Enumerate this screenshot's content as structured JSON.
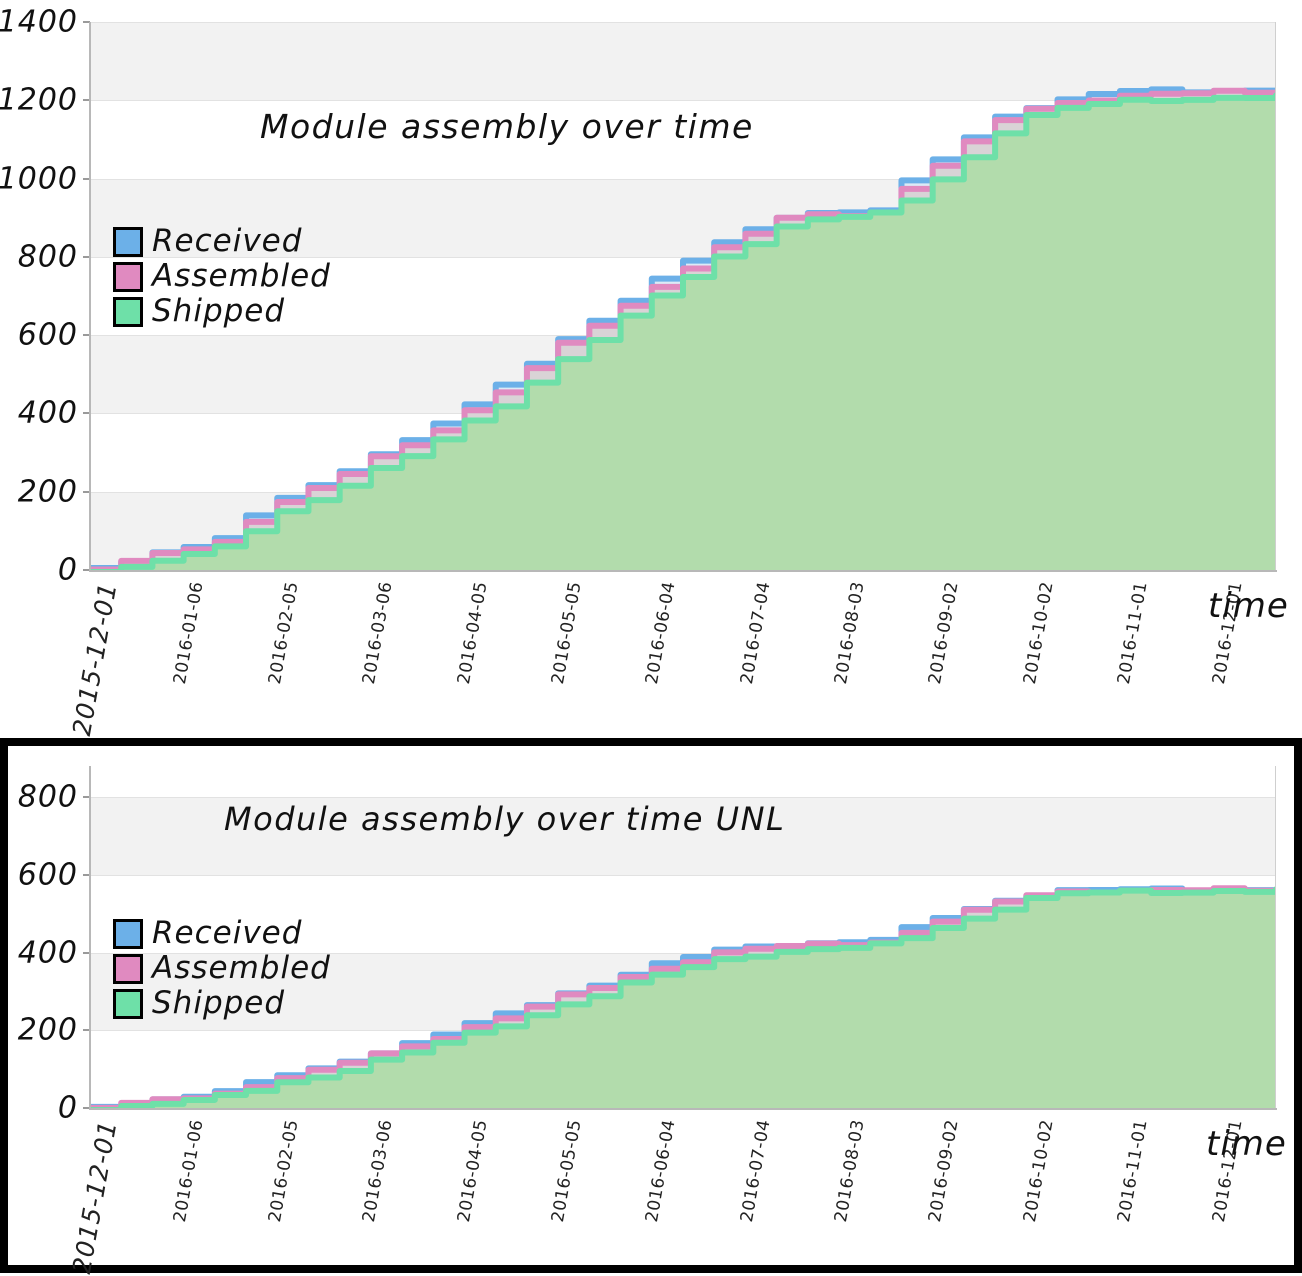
{
  "page": {
    "background": "#ffffff",
    "style": "xkcd-handdrawn"
  },
  "colors": {
    "received_line": "#6cb0e8",
    "received_fill": "#dceaf6",
    "assembled_line": "#e08ac0",
    "assembled_fill": "#d9d3d6",
    "shipped_line": "#6ee0a8",
    "shipped_fill": "#b2dcac",
    "band": "#f2f2f2",
    "grid": "#e2e2e2",
    "text": "#111111",
    "border": "#000000"
  },
  "charts": [
    {
      "id": "module-assembly-over-time",
      "title": "Module assembly over time",
      "xlabel": "time",
      "ylabel": "",
      "legend": [
        {
          "name": "Received",
          "color": "#6cb0e8"
        },
        {
          "name": "Assembled",
          "color": "#e08ac0"
        },
        {
          "name": "Shipped",
          "color": "#6ee0a8"
        }
      ],
      "yticks": [
        "0",
        "200",
        "400",
        "600",
        "800",
        "1000",
        "1200",
        "1400"
      ],
      "xticks": [
        "2015-12-01",
        "2016-01-06",
        "2016-02-05",
        "2016-03-06",
        "2016-04-05",
        "2016-05-05",
        "2016-06-04",
        "2016-07-04",
        "2016-08-03",
        "2016-09-02",
        "2016-10-02",
        "2016-11-01",
        "2016-12-01"
      ]
    },
    {
      "id": "module-assembly-over-time-unl",
      "title": "Module assembly over time  UNL",
      "xlabel": "time",
      "ylabel": "",
      "legend": [
        {
          "name": "Received",
          "color": "#6cb0e8"
        },
        {
          "name": "Assembled",
          "color": "#e08ac0"
        },
        {
          "name": "Shipped",
          "color": "#6ee0a8"
        }
      ],
      "yticks": [
        "0",
        "200",
        "400",
        "600",
        "800"
      ],
      "xticks": [
        "2015-12-01",
        "2016-01-06",
        "2016-02-05",
        "2016-03-06",
        "2016-04-05",
        "2016-05-05",
        "2016-06-04",
        "2016-07-04",
        "2016-08-03",
        "2016-09-02",
        "2016-10-02",
        "2016-11-01",
        "2016-12-01"
      ]
    }
  ],
  "chart_data": [
    {
      "type": "area",
      "id": "module-assembly-over-time",
      "title": "Module assembly over time",
      "xlabel": "time",
      "ylabel": "",
      "ylim": [
        0,
        1400
      ],
      "yticks": [
        0,
        200,
        400,
        600,
        800,
        1000,
        1200,
        1400
      ],
      "grid": true,
      "legend_position": "upper-left-inside",
      "x": [
        "2015-12-01",
        "2015-12-11",
        "2015-12-21",
        "2015-12-31",
        "2016-01-06",
        "2016-01-16",
        "2016-01-26",
        "2016-02-05",
        "2016-02-15",
        "2016-02-25",
        "2016-03-06",
        "2016-03-16",
        "2016-03-26",
        "2016-04-05",
        "2016-04-15",
        "2016-04-25",
        "2016-05-05",
        "2016-05-15",
        "2016-05-25",
        "2016-06-04",
        "2016-06-14",
        "2016-06-24",
        "2016-07-04",
        "2016-07-14",
        "2016-07-24",
        "2016-08-03",
        "2016-08-13",
        "2016-08-23",
        "2016-09-02",
        "2016-09-12",
        "2016-09-22",
        "2016-10-02",
        "2016-10-12",
        "2016-10-22",
        "2016-11-01",
        "2016-11-11",
        "2016-11-21",
        "2016-12-01",
        "2016-12-16"
      ],
      "series": [
        {
          "name": "Received",
          "color": "#6cb0e8",
          "values": [
            5,
            25,
            45,
            62,
            80,
            135,
            185,
            215,
            255,
            300,
            330,
            375,
            420,
            470,
            530,
            590,
            640,
            690,
            740,
            790,
            835,
            870,
            905,
            912,
            915,
            918,
            990,
            1050,
            1105,
            1160,
            1185,
            1200,
            1215,
            1222,
            1224,
            1224,
            1225,
            1226,
            1226
          ]
        },
        {
          "name": "Assembled",
          "color": "#e08ac0",
          "values": [
            2,
            20,
            40,
            56,
            72,
            126,
            176,
            205,
            245,
            288,
            318,
            362,
            408,
            455,
            515,
            575,
            625,
            675,
            725,
            775,
            822,
            858,
            898,
            905,
            908,
            910,
            975,
            1035,
            1090,
            1148,
            1178,
            1192,
            1205,
            1212,
            1216,
            1218,
            1219,
            1220,
            1220
          ]
        },
        {
          "name": "Shipped",
          "color": "#6ee0a8",
          "values": [
            0,
            8,
            25,
            40,
            55,
            100,
            150,
            180,
            220,
            258,
            290,
            332,
            378,
            422,
            480,
            540,
            590,
            645,
            700,
            748,
            800,
            838,
            878,
            895,
            902,
            908,
            945,
            1000,
            1055,
            1120,
            1160,
            1178,
            1190,
            1198,
            1202,
            1204,
            1206,
            1208,
            1208
          ]
        }
      ]
    },
    {
      "type": "area",
      "id": "module-assembly-over-time-unl",
      "title": "Module assembly over time  UNL",
      "xlabel": "time",
      "ylabel": "",
      "ylim": [
        0,
        880
      ],
      "yticks": [
        0,
        200,
        400,
        600,
        800
      ],
      "grid": true,
      "legend_position": "upper-left-inside",
      "x": [
        "2015-12-01",
        "2015-12-11",
        "2015-12-21",
        "2015-12-31",
        "2016-01-06",
        "2016-01-16",
        "2016-01-26",
        "2016-02-05",
        "2016-02-15",
        "2016-02-25",
        "2016-03-06",
        "2016-03-16",
        "2016-03-26",
        "2016-04-05",
        "2016-04-15",
        "2016-04-25",
        "2016-05-05",
        "2016-05-15",
        "2016-05-25",
        "2016-06-04",
        "2016-06-14",
        "2016-06-24",
        "2016-07-04",
        "2016-07-14",
        "2016-07-24",
        "2016-08-03",
        "2016-08-13",
        "2016-08-23",
        "2016-09-02",
        "2016-09-12",
        "2016-09-22",
        "2016-10-02",
        "2016-10-12",
        "2016-10-22",
        "2016-11-01",
        "2016-11-11",
        "2016-11-21",
        "2016-12-01",
        "2016-12-16"
      ],
      "series": [
        {
          "name": "Received",
          "color": "#6cb0e8",
          "values": [
            3,
            12,
            22,
            32,
            42,
            62,
            85,
            100,
            122,
            145,
            165,
            190,
            215,
            240,
            268,
            295,
            318,
            345,
            368,
            388,
            405,
            415,
            420,
            424,
            428,
            432,
            460,
            490,
            512,
            535,
            550,
            558,
            560,
            561,
            561,
            562,
            562,
            562,
            562
          ]
        },
        {
          "name": "Assembled",
          "color": "#e08ac0",
          "values": [
            1,
            10,
            19,
            28,
            37,
            57,
            79,
            94,
            116,
            138,
            158,
            183,
            208,
            232,
            260,
            287,
            310,
            337,
            360,
            380,
            398,
            409,
            415,
            419,
            423,
            427,
            452,
            482,
            505,
            530,
            547,
            556,
            558,
            559,
            560,
            560,
            560,
            560,
            560
          ]
        },
        {
          "name": "Shipped",
          "color": "#6ee0a8",
          "values": [
            0,
            5,
            12,
            20,
            28,
            45,
            66,
            80,
            100,
            122,
            142,
            166,
            190,
            214,
            240,
            268,
            290,
            318,
            342,
            362,
            382,
            395,
            402,
            408,
            412,
            418,
            438,
            465,
            488,
            515,
            538,
            550,
            554,
            556,
            557,
            557,
            558,
            558,
            558
          ]
        }
      ]
    }
  ]
}
